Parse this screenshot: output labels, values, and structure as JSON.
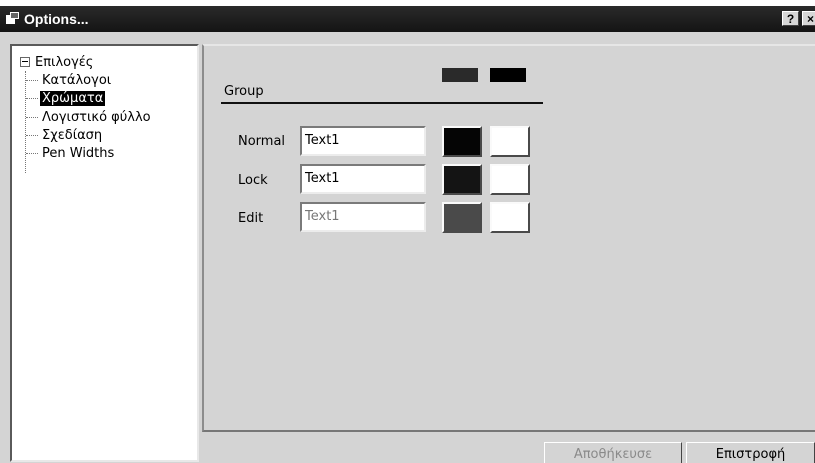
{
  "window": {
    "title": "Options...",
    "help_label": "?",
    "close_label": "×"
  },
  "tree": {
    "root_label": "Επιλογές",
    "items": [
      {
        "label": "Κατάλογοι",
        "selected": false
      },
      {
        "label": "Χρώματα",
        "selected": true
      },
      {
        "label": "Λογιστικό φύλλο",
        "selected": false
      },
      {
        "label": "Σχεδίαση",
        "selected": false
      },
      {
        "label": "Pen Widths",
        "selected": false
      }
    ]
  },
  "group": {
    "label": "Group",
    "swatch_colors": [
      "#2a2a2a",
      "#000000"
    ]
  },
  "rows": [
    {
      "label": "Normal",
      "value": "Text1",
      "disabled": false,
      "fg_color": "#050505",
      "bg_color": "#ffffff"
    },
    {
      "label": "Lock",
      "value": "Text1",
      "disabled": false,
      "fg_color": "#141414",
      "bg_color": "#ffffff"
    },
    {
      "label": "Edit",
      "value": "Text1",
      "disabled": true,
      "fg_color": "#4a4a4a",
      "bg_color": "#ffffff"
    }
  ],
  "footer": {
    "save_label": "Αποθήκευσε",
    "save_enabled": false,
    "back_label": "Επιστροφή"
  }
}
